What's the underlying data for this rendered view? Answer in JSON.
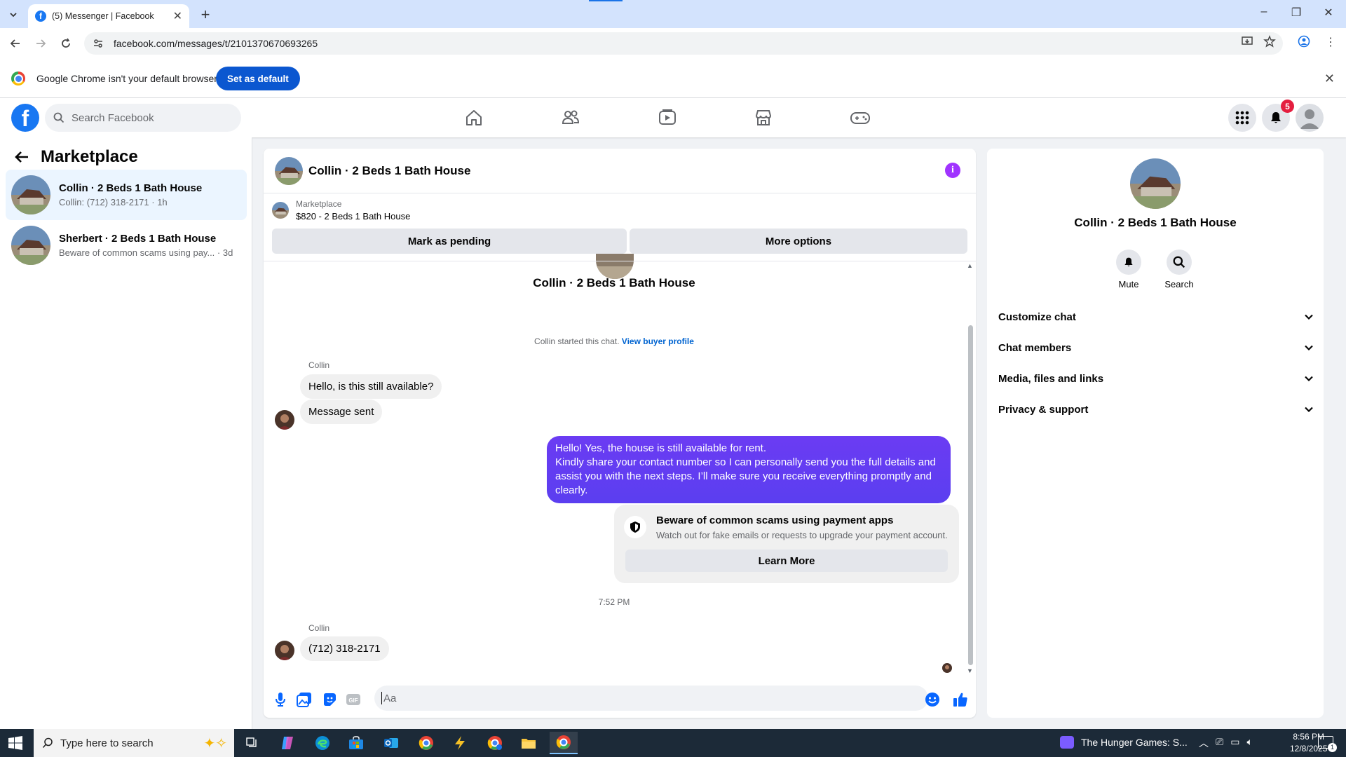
{
  "browser": {
    "tab_title": "(5) Messenger | Facebook",
    "url": "facebook.com/messages/t/2101370670693265",
    "infobar_message": "Google Chrome isn't your default browser",
    "set_default_label": "Set as default"
  },
  "fb_nav": {
    "search_placeholder": "Search Facebook",
    "notification_count": "5",
    "icons": [
      "home-icon",
      "friends-icon",
      "watch-icon",
      "marketplace-icon",
      "gaming-icon",
      "menu-grid-icon",
      "bell-icon",
      "account-icon"
    ]
  },
  "sidebar": {
    "title": "Marketplace",
    "chats": [
      {
        "name": "Collin · 2 Beds 1 Bath House",
        "preview": "Collin: (712) 318-2171 · 1h",
        "active": true
      },
      {
        "name": "Sherbert · 2 Beds 1 Bath House",
        "preview": "Beware of common scams using pay...",
        "time": " · 3d",
        "active": false
      }
    ]
  },
  "conversation": {
    "title": "Collin · 2 Beds 1 Bath House",
    "listing_source": "Marketplace",
    "listing_price": "$820 - 2 Beds 1 Bath House",
    "mark_pending_label": "Mark as pending",
    "more_options_label": "More options",
    "thread_title": "Collin · 2 Beds 1 Bath House",
    "started_text": "Collin started this chat. ",
    "view_buyer_profile": "View buyer profile",
    "messages": [
      {
        "sender": "Collin",
        "text": "Hello, is this still available?"
      },
      {
        "sender": "Collin",
        "text": "Message sent"
      },
      {
        "sender": "me",
        "lines": [
          "Hello! Yes, the house is still available for rent.",
          "Kindly share your contact number so I can personally send you the full details and assist you with the next steps. I’ll make sure you receive everything promptly and clearly."
        ]
      },
      {
        "sender": "Collin",
        "text": "(712) 318-2171"
      }
    ],
    "scam_card": {
      "heading": "Beware of common scams using payment apps",
      "detail": "Watch out for fake emails or requests to upgrade your payment account.",
      "button": "Learn More"
    },
    "timestamp": "7:52 PM",
    "input_placeholder": "Aa"
  },
  "right_panel": {
    "name": "Collin · 2 Beds 1 Bath House",
    "actions": [
      {
        "label": "Mute",
        "icon": "bell-icon"
      },
      {
        "label": "Search",
        "icon": "search-icon"
      }
    ],
    "sections": [
      "Customize chat",
      "Chat members",
      "Media, files and links",
      "Privacy & support"
    ]
  },
  "taskbar": {
    "search_placeholder": "Type here to search",
    "media_title": "The Hunger Games: S...",
    "time": "8:56 PM",
    "date": "12/8/2025",
    "notification_count": "1"
  },
  "colors": {
    "fb_blue": "#1877f2",
    "outgoing_bubble": "#6b3cf3",
    "info_purple": "#a033ff",
    "active_chat_bg": "#ebf5ff"
  }
}
